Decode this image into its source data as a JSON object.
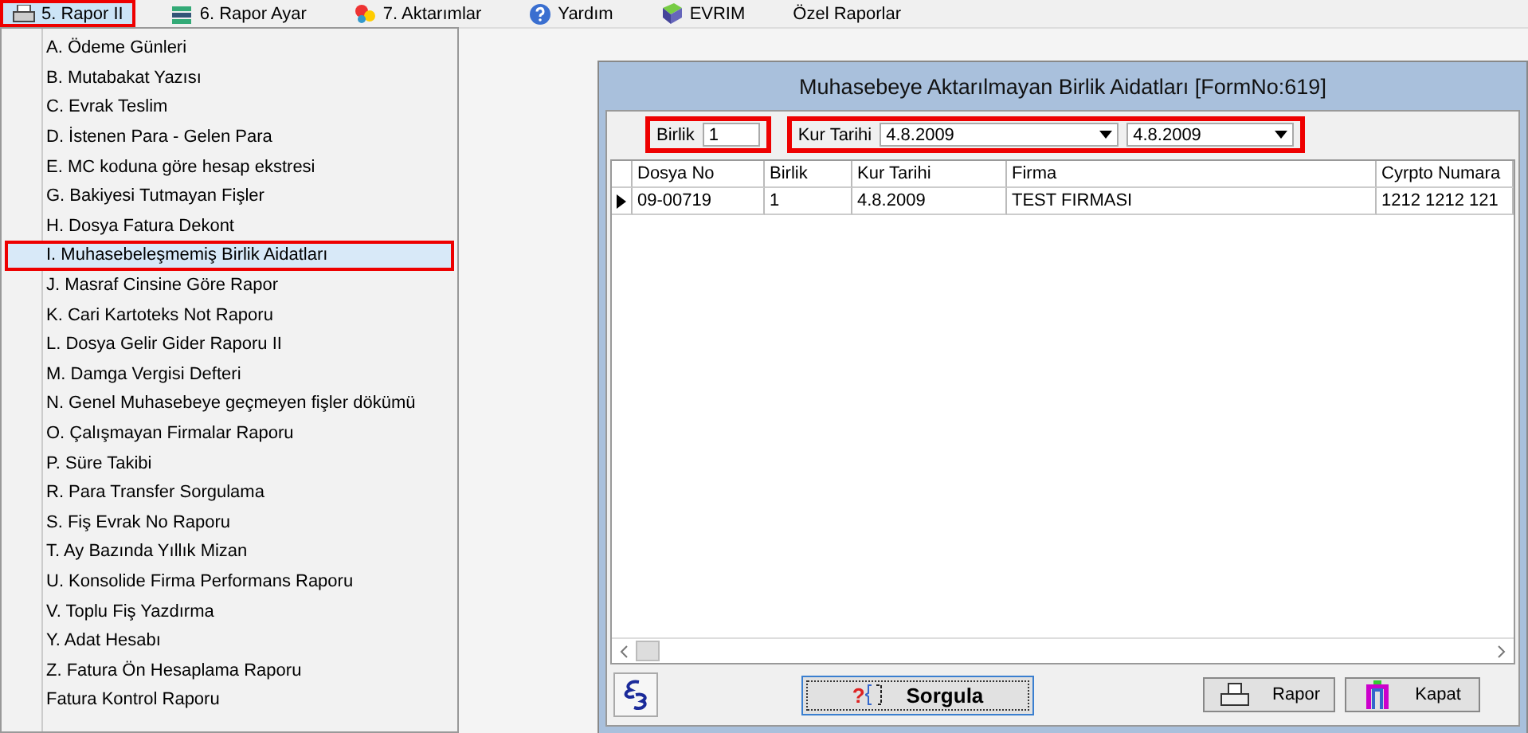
{
  "menubar": [
    {
      "label": "5.  Rapor II",
      "selected": true,
      "highlighted": true
    },
    {
      "label": "6.  Rapor Ayar",
      "selected": false,
      "highlighted": false
    },
    {
      "label": "7.  Aktarımlar",
      "selected": false,
      "highlighted": false
    },
    {
      "label": "Yardım",
      "selected": false,
      "highlighted": false
    },
    {
      "label": "EVRIM",
      "selected": false,
      "highlighted": false
    },
    {
      "label": "Özel Raporlar",
      "selected": false,
      "highlighted": false
    }
  ],
  "dropdown": {
    "items": [
      {
        "label": "A.  Ödeme Günleri",
        "selected": false,
        "highlighted": false
      },
      {
        "label": "B.  Mutabakat Yazısı",
        "selected": false,
        "highlighted": false
      },
      {
        "label": "C.  Evrak Teslim",
        "selected": false,
        "highlighted": false
      },
      {
        "label": "D.  İstenen Para - Gelen Para",
        "selected": false,
        "highlighted": false
      },
      {
        "label": "E.  MC koduna göre hesap ekstresi",
        "selected": false,
        "highlighted": false
      },
      {
        "label": "G.  Bakiyesi Tutmayan Fişler",
        "selected": false,
        "highlighted": false
      },
      {
        "label": "H.  Dosya Fatura Dekont",
        "selected": false,
        "highlighted": false
      },
      {
        "label": "I.  Muhasebeleşmemiş Birlik Aidatları",
        "selected": true,
        "highlighted": true
      },
      {
        "label": "J.  Masraf Cinsine Göre Rapor",
        "selected": false,
        "highlighted": false
      },
      {
        "label": "K.  Cari Kartoteks Not Raporu",
        "selected": false,
        "highlighted": false
      },
      {
        "label": "L.  Dosya Gelir Gider Raporu II",
        "selected": false,
        "highlighted": false
      },
      {
        "label": "M. Damga Vergisi Defteri",
        "selected": false,
        "highlighted": false
      },
      {
        "label": "N.  Genel Muhasebeye geçmeyen fişler dökümü",
        "selected": false,
        "highlighted": false
      },
      {
        "label": "O.  Çalışmayan Firmalar Raporu",
        "selected": false,
        "highlighted": false
      },
      {
        "label": "P.  Süre Takibi",
        "selected": false,
        "highlighted": false
      },
      {
        "label": "R. Para Transfer Sorgulama",
        "selected": false,
        "highlighted": false
      },
      {
        "label": "S. Fiş Evrak No Raporu",
        "selected": false,
        "highlighted": false
      },
      {
        "label": "T. Ay Bazında Yıllık Mizan",
        "selected": false,
        "highlighted": false
      },
      {
        "label": "U. Konsolide Firma Performans Raporu",
        "selected": false,
        "highlighted": false
      },
      {
        "label": "V. Toplu Fiş Yazdırma",
        "selected": false,
        "highlighted": false
      },
      {
        "label": "Y. Adat Hesabı",
        "selected": false,
        "highlighted": false
      },
      {
        "label": "Z. Fatura Ön Hesaplama Raporu",
        "selected": false,
        "highlighted": false
      },
      {
        "label": "Fatura Kontrol Raporu",
        "selected": false,
        "highlighted": false
      }
    ]
  },
  "window": {
    "title": "Muhasebeye Aktarılmayan Birlik Aidatları [FormNo:619]",
    "filters": {
      "birlik": {
        "label": "Birlik",
        "value": "1",
        "highlighted": true
      },
      "kur_tarihi": {
        "label": "Kur Tarihi",
        "from": "4.8.2009",
        "to": "4.8.2009",
        "highlighted": true
      }
    },
    "table": {
      "columns": [
        "Dosya No",
        "Birlik",
        "Kur Tarihi",
        "Firma",
        "Cyrpto Numara"
      ],
      "rows": [
        {
          "cells": [
            "09-00719",
            "1",
            "4.8.2009",
            "TEST FIRMASI",
            "1212 1212 121"
          ],
          "selected": true
        }
      ]
    },
    "buttons": [
      {
        "label": "Sorgula",
        "symbol": "?",
        "focused": true
      },
      {
        "label": "Rapor",
        "focused": false
      },
      {
        "label": "Kapat",
        "focused": false
      }
    ]
  }
}
